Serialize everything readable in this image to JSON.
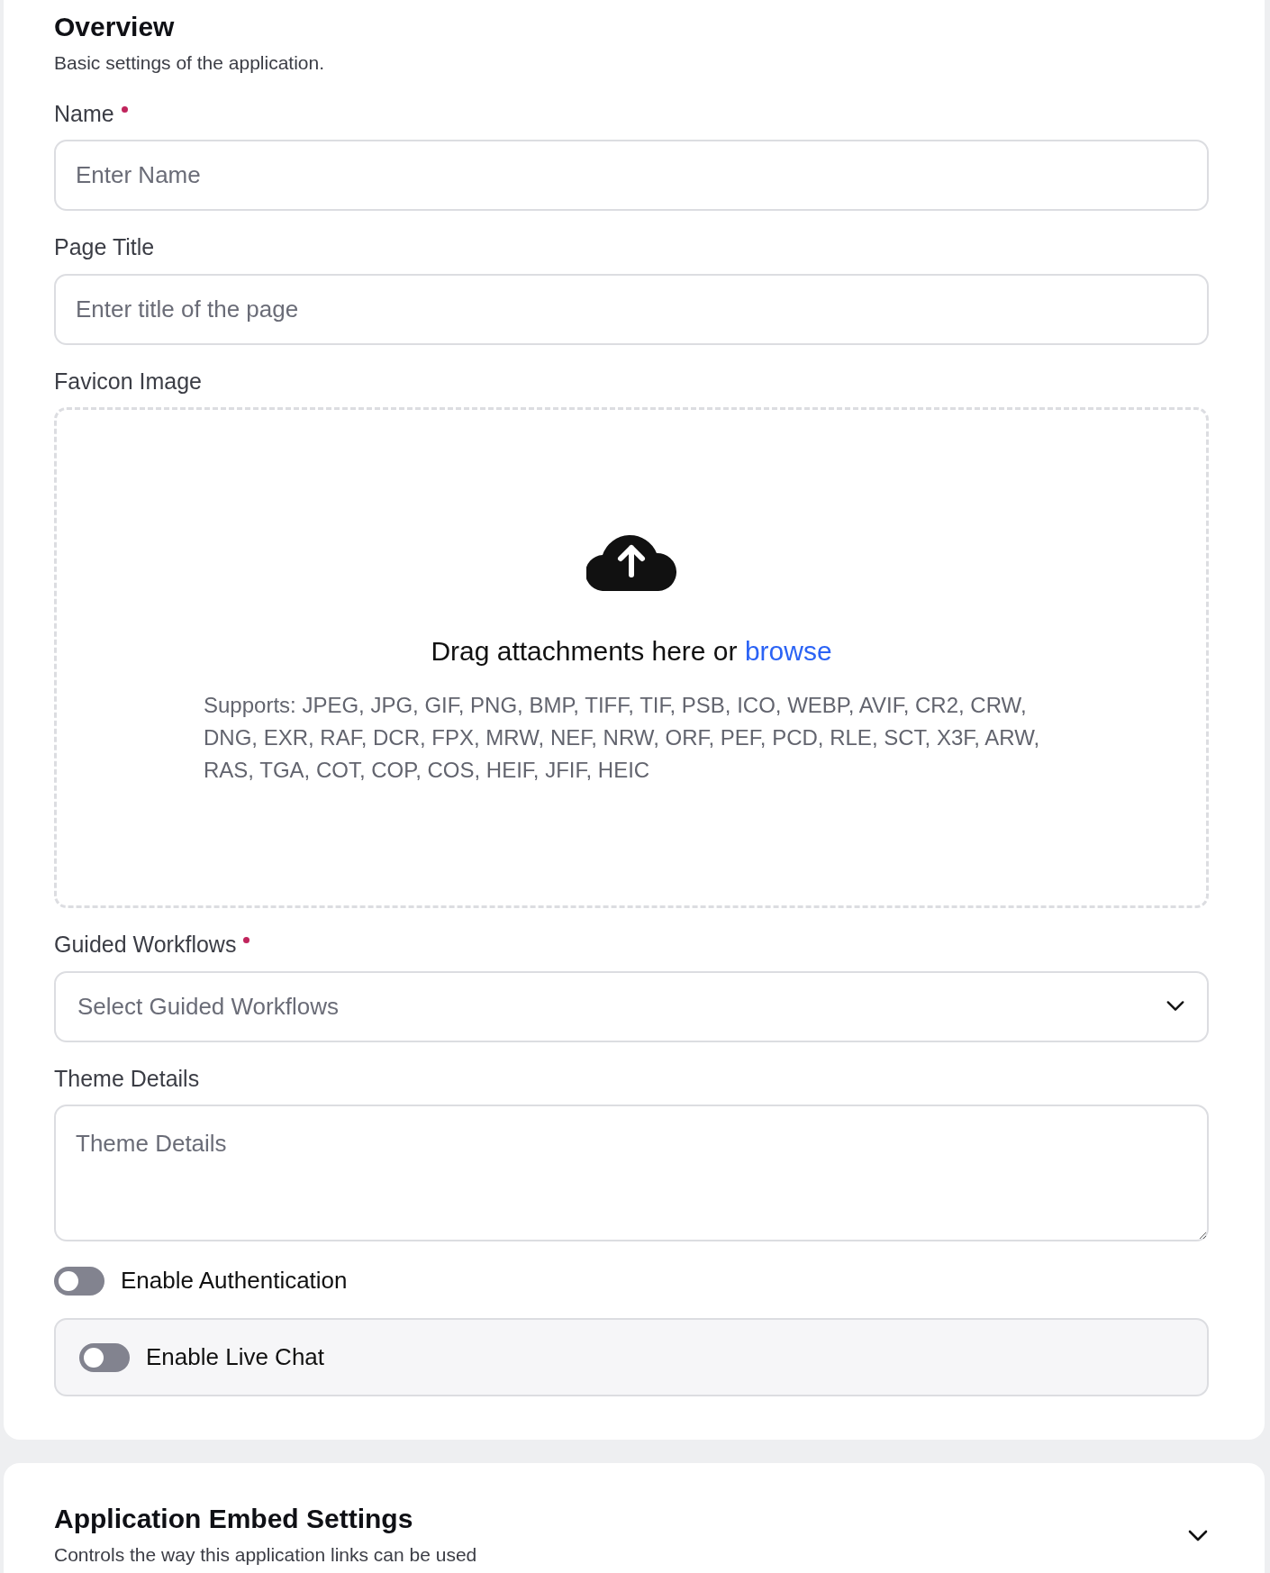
{
  "overview": {
    "title": "Overview",
    "subtitle": "Basic settings of the application.",
    "fields": [
      {
        "kind": "input",
        "label": "Name",
        "required": true,
        "placeholder": "Enter Name"
      },
      {
        "kind": "input",
        "label": "Page Title",
        "required": false,
        "placeholder": "Enter title of the page"
      },
      {
        "kind": "upload",
        "label": "Favicon Image",
        "required": false,
        "prompt": "Drag attachments here or",
        "link": "browse",
        "supports": "Supports: JPEG, JPG, GIF, PNG, BMP, TIFF, TIF, PSB, ICO, WEBP, AVIF, CR2, CRW, DNG, EXR, RAF, DCR, FPX, MRW, NEF, NRW, ORF, PEF, PCD, RLE, SCT, X3F, ARW, RAS, TGA, COT, COP, COS, HEIF, JFIF, HEIC"
      },
      {
        "kind": "select",
        "label": "Guided Workflows",
        "required": true,
        "placeholder": "Select Guided Workflows"
      },
      {
        "kind": "textarea",
        "label": "Theme Details",
        "required": false,
        "placeholder": "Theme Details"
      }
    ],
    "toggles": [
      {
        "kind": "plain",
        "label": "Enable Authentication",
        "on": false
      },
      {
        "kind": "boxed",
        "label": "Enable Live Chat",
        "on": false
      }
    ]
  },
  "embed": {
    "title": "Application Embed Settings",
    "subtitle": "Controls the way this application links can be used",
    "expanded": false
  }
}
